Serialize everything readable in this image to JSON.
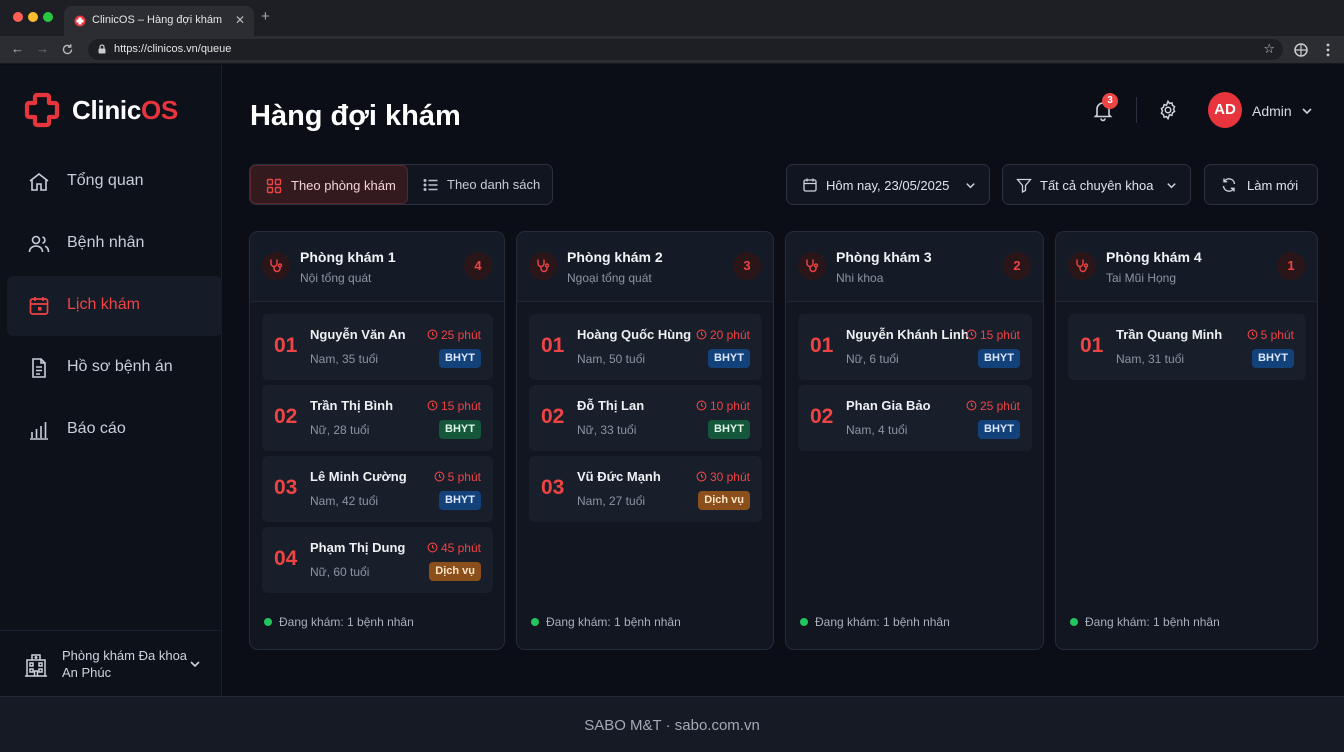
{
  "browser": {
    "tab_title": "ClinicOS – Hàng đợi khám",
    "url": "https://clinicos.vn/queue"
  },
  "brand": {
    "name_main": "Clinic",
    "name_accent": "OS",
    "color": "#e8343c"
  },
  "sidebar": {
    "items": [
      {
        "label": "Tổng quan",
        "icon": "home-icon"
      },
      {
        "label": "Bệnh nhân",
        "icon": "users-icon"
      },
      {
        "label": "Lịch khám",
        "icon": "calendar-icon",
        "active": true
      },
      {
        "label": "Hồ sơ bệnh án",
        "icon": "document-icon"
      },
      {
        "label": "Báo cáo",
        "icon": "bar-chart-icon"
      }
    ],
    "clinic_name": "Phòng khám Đa khoa An Phúc"
  },
  "header": {
    "title": "Hàng đợi khám",
    "notification_count": "3",
    "avatar_initials": "AD",
    "user_name": "Admin"
  },
  "toolbar": {
    "view_by_room": "Theo phòng khám",
    "view_by_list": "Theo danh sách",
    "date_filter": "Hôm nay, 23/05/2025",
    "specialty_filter": "Tất cả chuyên khoa",
    "refresh": "Làm mới"
  },
  "rooms": [
    {
      "name": "Phòng khám 1",
      "specialty": "Nội tổng quát",
      "count": "4",
      "patients": [
        {
          "no": "01",
          "name": "Nguyễn Văn An",
          "info": "Nam, 35 tuổi",
          "wait": "25 phút",
          "tag": "BHYT"
        },
        {
          "no": "02",
          "name": "Trần Thị Bình",
          "info": "Nữ, 28 tuổi",
          "wait": "15 phút",
          "tag": "BHYT"
        },
        {
          "no": "03",
          "name": "Lê Minh Cường",
          "info": "Nam, 42 tuổi",
          "wait": "5 phút",
          "tag": "BHYT"
        },
        {
          "no": "04",
          "name": "Phạm Thị Dung",
          "info": "Nữ, 60 tuổi",
          "wait": "45 phút",
          "tag": "Dịch vụ"
        }
      ],
      "footer": "Đang khám: 1 bệnh nhân"
    },
    {
      "name": "Phòng khám 2",
      "specialty": "Ngoại tổng quát",
      "count": "3",
      "patients": [
        {
          "no": "01",
          "name": "Hoàng Quốc Hùng",
          "info": "Nam, 50 tuổi",
          "wait": "20 phút",
          "tag": "BHYT"
        },
        {
          "no": "02",
          "name": "Đỗ Thị Lan",
          "info": "Nữ, 33 tuổi",
          "wait": "10 phút",
          "tag": "BHYT"
        },
        {
          "no": "03",
          "name": "Vũ Đức Mạnh",
          "info": "Nam, 27 tuổi",
          "wait": "30 phút",
          "tag": "Dịch vụ"
        }
      ],
      "footer": "Đang khám: 1 bệnh nhân"
    },
    {
      "name": "Phòng khám 3",
      "specialty": "Nhi khoa",
      "count": "2",
      "patients": [
        {
          "no": "01",
          "name": "Nguyễn Khánh Linh",
          "info": "Nữ, 6 tuổi",
          "wait": "15 phút",
          "tag": "BHYT"
        },
        {
          "no": "02",
          "name": "Phan Gia Bảo",
          "info": "Nam, 4 tuổi",
          "wait": "25 phút",
          "tag": "BHYT"
        }
      ],
      "footer": "Đang khám: 1 bệnh nhân"
    },
    {
      "name": "Phòng khám 4",
      "specialty": "Tai Mũi Họng",
      "count": "1",
      "patients": [
        {
          "no": "01",
          "name": "Trần Quang Minh",
          "info": "Nam, 31 tuổi",
          "wait": "5 phút",
          "tag": "BHYT"
        }
      ],
      "footer": "Đang khám: 1 bệnh nhân"
    }
  ],
  "footer": {
    "text": "SABO M&T · sabo.com.vn"
  },
  "colors": {
    "accent": "#ef4444",
    "bhyt": "#13417a",
    "service": "#8a4f1a",
    "active_dot": "#22c55e"
  }
}
